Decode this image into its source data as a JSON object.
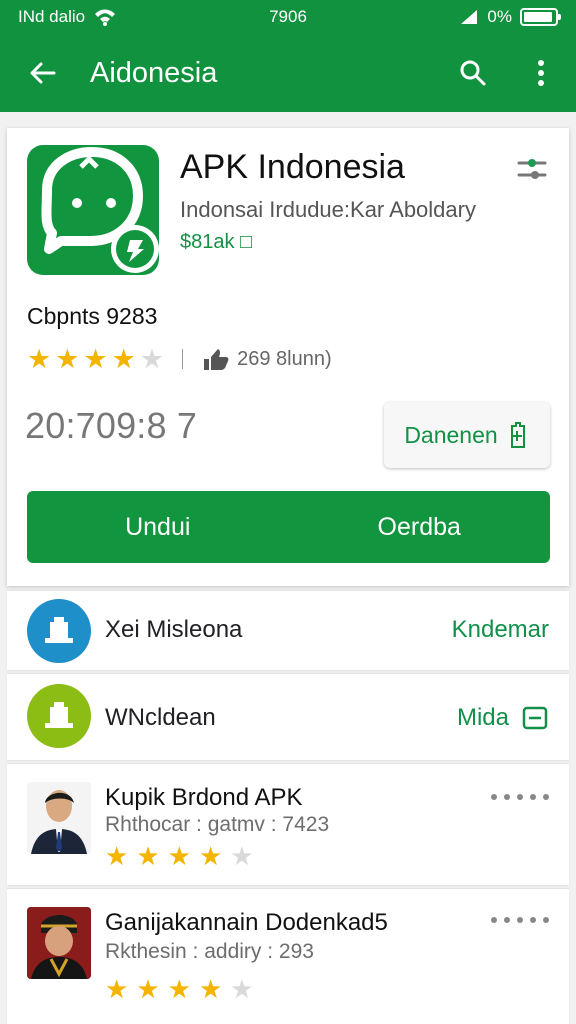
{
  "status_bar": {
    "left_text": "INd dalio",
    "time": "7906",
    "battery": "0%"
  },
  "app_bar": {
    "title": "Aidonesia",
    "icons": [
      "back-arrow-icon",
      "search-icon",
      "more-vert-icon"
    ]
  },
  "app": {
    "name": "APK Indonesia",
    "developer": "Indonsai Irdudue:Kar Aboldary",
    "price": "$81ak □",
    "contents_label": "Cbpnts 9283",
    "rating_stars": 4,
    "reviews": "269 8lunn)",
    "downloads": "20:709:8 7",
    "secondary_button": "Danenen",
    "primary_left": "Undui",
    "primary_right": "Oerdba",
    "accent": "#11923f"
  },
  "rows": [
    {
      "label": "Xei Misleona",
      "action": "Kndemar",
      "icon_color": "#1f8fc9"
    },
    {
      "label": "WNcldean",
      "action": "Mida",
      "icon_color": "#8bbd15"
    }
  ],
  "items": [
    {
      "title": "Kupik Brdond APK",
      "subtitle": "Rhthocar : gatmv : 7423",
      "stars": 4
    },
    {
      "title": "Ganijakannain Dodenkad5",
      "subtitle": "Rkthesin : addiry : 293",
      "stars": 4
    }
  ]
}
